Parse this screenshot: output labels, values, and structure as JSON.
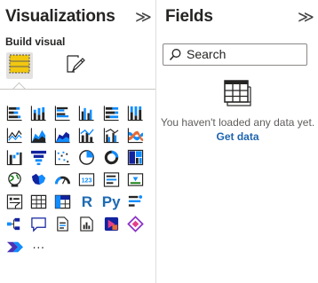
{
  "visualizations": {
    "title": "Visualizations",
    "collapse_glyph": "≫",
    "build_label": "Build visual",
    "modes": [
      {
        "name": "build-visual",
        "icon": "build-visual-icon",
        "active": true
      },
      {
        "name": "format-visual",
        "icon": "format-visual-icon",
        "active": false
      }
    ],
    "visuals": [
      [
        "stacked-bar-chart-icon",
        "stacked-column-chart-icon",
        "clustered-bar-chart-icon",
        "clustered-column-chart-icon",
        "100-stacked-bar-chart-icon",
        "100-stacked-column-chart-icon"
      ],
      [
        "line-chart-icon",
        "area-chart-icon",
        "stacked-area-chart-icon",
        "line-and-stacked-column-chart-icon",
        "line-and-clustered-column-chart-icon",
        "ribbon-chart-icon"
      ],
      [
        "waterfall-chart-icon",
        "funnel-chart-icon",
        "scatter-chart-icon",
        "pie-chart-icon",
        "donut-chart-icon",
        "treemap-icon"
      ],
      [
        "map-icon",
        "filled-map-icon",
        "gauge-icon",
        "card-icon",
        "multi-row-card-icon",
        "kpi-icon"
      ],
      [
        "slicer-icon",
        "table-icon",
        "matrix-icon",
        "r-script-visual-icon",
        "python-visual-icon",
        "key-influencers-icon"
      ],
      [
        "decomposition-tree-icon",
        "qa-icon",
        "smart-narrative-icon",
        "paginated-report-icon",
        "power-apps-icon",
        "power-automate-icon"
      ],
      [
        "power-automate-flow-icon",
        "more-visuals-icon"
      ]
    ],
    "r_label": "R",
    "py_label": "Py",
    "more_label": "···"
  },
  "fields": {
    "title": "Fields",
    "collapse_glyph": "≫",
    "search_placeholder": "Search",
    "empty_message": "You haven't loaded any data yet.",
    "get_data_label": "Get data"
  },
  "colors": {
    "accent_blue": "#118dff",
    "dark_blue": "#12239e",
    "orange": "#e66c37",
    "yellow": "#f2c80f",
    "link": "#1d64b0"
  }
}
